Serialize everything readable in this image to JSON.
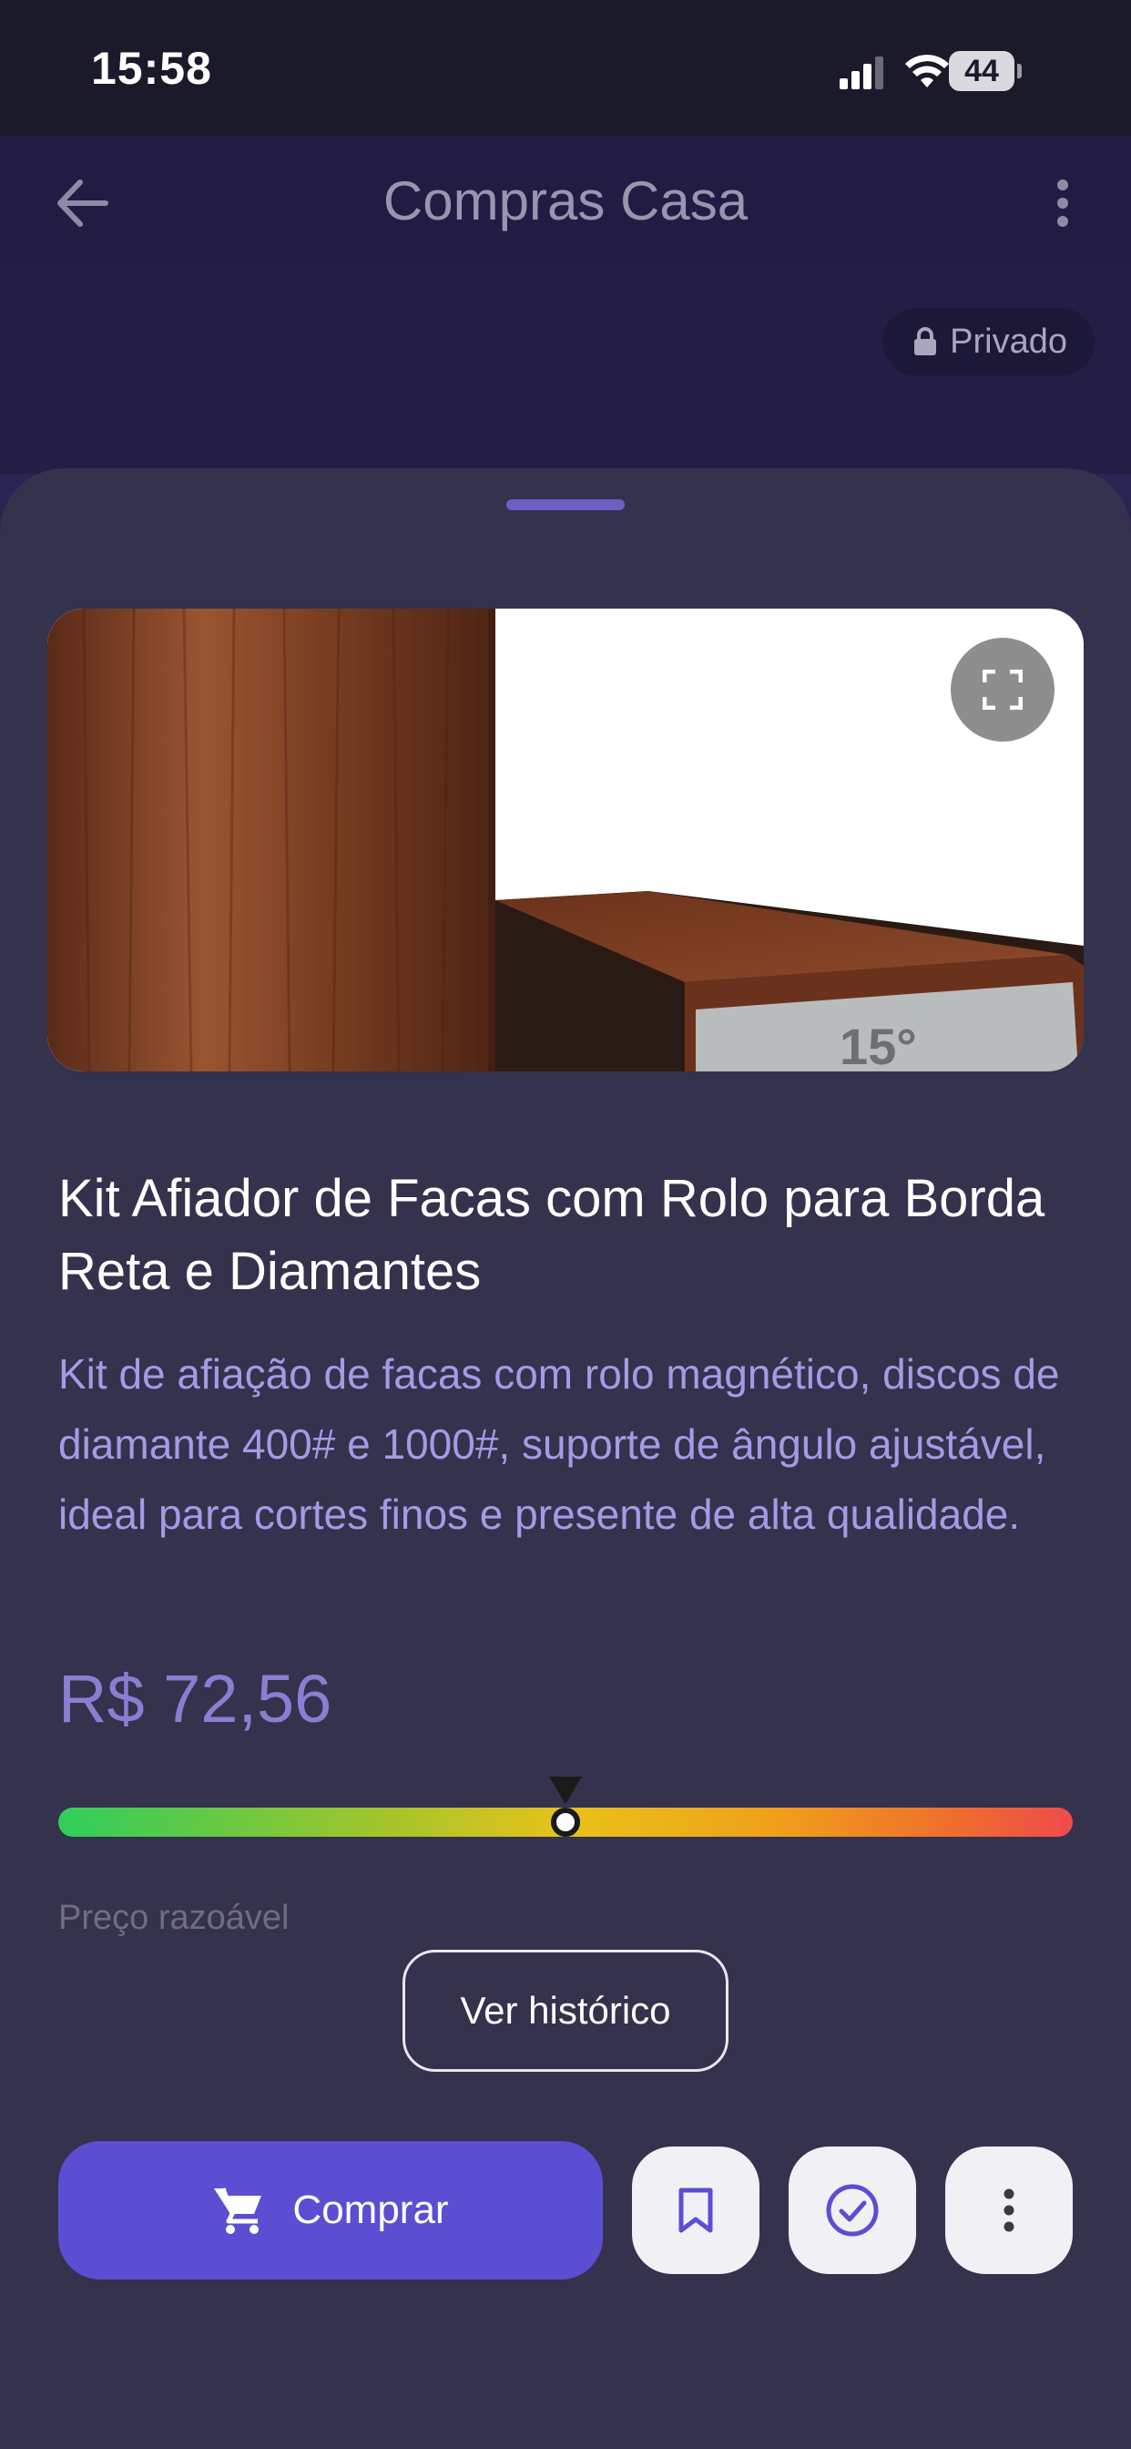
{
  "status_bar": {
    "time": "15:58",
    "battery_level": "44"
  },
  "header": {
    "title": "Compras Casa",
    "back_icon": "arrow-left-icon",
    "overflow_icon": "more-vertical-icon"
  },
  "privacy_badge": {
    "icon": "lock-icon",
    "label": "Privado"
  },
  "product": {
    "image_label": "15°",
    "title": "Kit Afiador de Facas com Rolo para Borda Reta e Diamantes",
    "description": "Kit de afiação de facas com rolo magnético, discos de diamante 400# e 1000#, suporte de ângulo ajustável, ideal para cortes finos e presente de alta qualidade.",
    "price": "R$ 72,56"
  },
  "price_meter": {
    "level_fraction": 0.5,
    "label": "Preço razoável",
    "colors": [
      "#2fce5b",
      "#e8c21a",
      "#ef4b4b"
    ]
  },
  "actions": {
    "history_label": "Ver histórico",
    "buy_label": "Comprar",
    "buy_icon": "cart-icon",
    "bookmark_icon": "bookmark-icon",
    "check_icon": "check-circle-icon",
    "more_icon": "more-vertical-icon"
  },
  "colors": {
    "accent": "#5b4ed2",
    "sheet_background": "#34324c",
    "description_text": "#a49ae6",
    "price_text": "#8a7ed2"
  }
}
